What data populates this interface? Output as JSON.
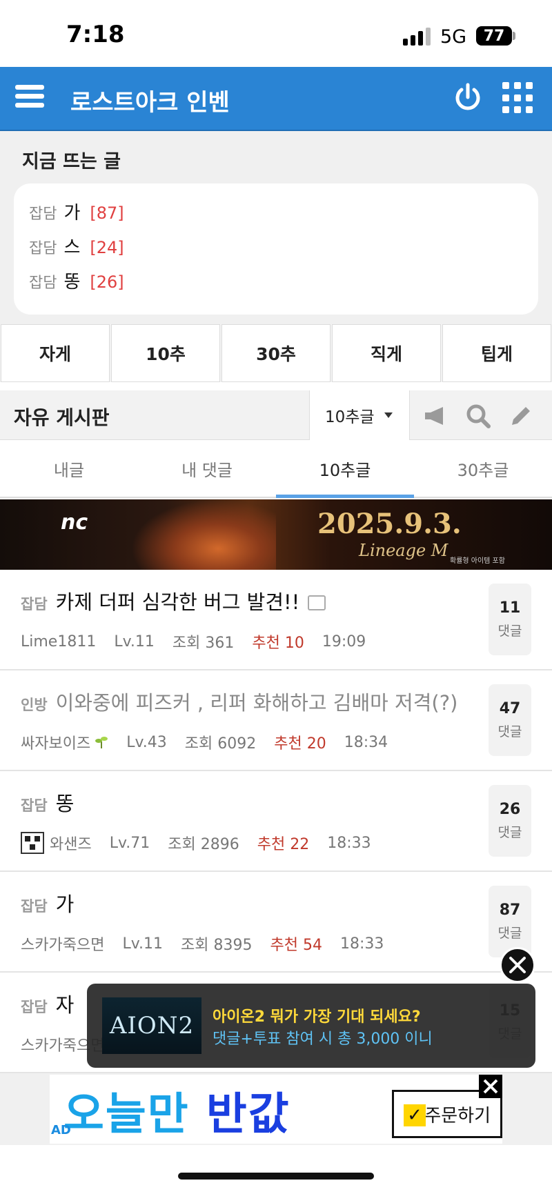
{
  "status": {
    "time": "7:18",
    "network": "5G",
    "battery": "77"
  },
  "header": {
    "title": "로스트아크 인벤"
  },
  "hot": {
    "title": "지금 뜨는 글",
    "items": [
      {
        "cat": "잡담",
        "text": "가",
        "count": "[87]"
      },
      {
        "cat": "잡담",
        "text": "스",
        "count": "[24]"
      },
      {
        "cat": "잡담",
        "text": "똥",
        "count": "[26]"
      }
    ]
  },
  "categories": [
    "자게",
    "10추",
    "30추",
    "직게",
    "팁게"
  ],
  "board": {
    "title": "자유 게시판",
    "filter": "10추글"
  },
  "subtabs": [
    "내글",
    "내 댓글",
    "10추글",
    "30추글"
  ],
  "subtabs_active": "10추글",
  "banner": {
    "logo": "nc",
    "date": "2025.9.3.",
    "brand": "Lineage M",
    "fine": "확률형 아이템 포함"
  },
  "posts": [
    {
      "cat": "잡담",
      "title": "카제 더퍼 심각한 버그 발견!!",
      "author": "Lime1811",
      "level": "Lv.11",
      "views": "조회 361",
      "rec": "추천 10",
      "time": "19:09",
      "comments": "11",
      "comments_label": "댓글"
    },
    {
      "cat": "인방",
      "title": "이와중에 피즈커 , 리퍼 화해하고 김배마 저격(?)",
      "author": "싸자보이즈",
      "level": "Lv.43",
      "views": "조회 6092",
      "rec": "추천 20",
      "time": "18:34",
      "comments": "47",
      "comments_label": "댓글"
    },
    {
      "cat": "잡담",
      "title": "똥",
      "author": "와샌즈",
      "level": "Lv.71",
      "views": "조회 2896",
      "rec": "추천 22",
      "time": "18:33",
      "comments": "26",
      "comments_label": "댓글"
    },
    {
      "cat": "잡담",
      "title": "가",
      "author": "스카가죽으면",
      "level": "Lv.11",
      "views": "조회 8395",
      "rec": "추천 54",
      "time": "18:33",
      "comments": "87",
      "comments_label": "댓글"
    },
    {
      "cat": "잡담",
      "title": "자",
      "author": "스카가죽으면",
      "level": "",
      "views": "",
      "rec": "",
      "time": "",
      "comments": "15",
      "comments_label": "댓글"
    }
  ],
  "promo": {
    "thumb": "AION2",
    "line1": "아이온2 뭐가 가장 기대 되세요?",
    "line2": "댓글+투표 참여 시 총 3,000 이니"
  },
  "ad": {
    "headline_a": "오늘만",
    "headline_b": "반값",
    "order": "주문하기",
    "label": "AD"
  }
}
